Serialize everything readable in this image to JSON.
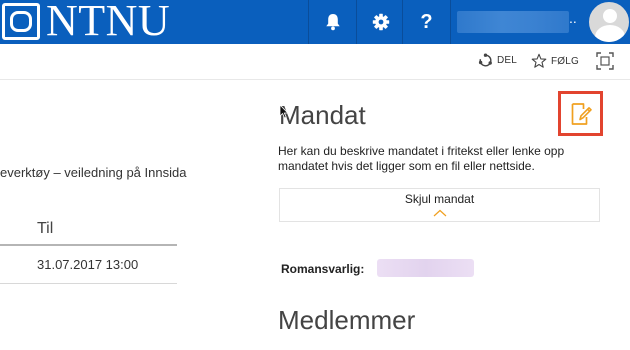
{
  "brand": {
    "logo_text": "NTNU"
  },
  "suite_bar": {
    "notifications_icon": "bell-icon",
    "settings_icon": "gear-icon",
    "help_label": "?",
    "user_dots": "..",
    "bg_color": "#0a5fbd"
  },
  "action_bar": {
    "share_label": "DEL",
    "follow_label": "FØLG",
    "focus_icon": "focus-mode-icon"
  },
  "left_panel": {
    "partial_text": "everktøy – veiledning på Innsida",
    "table": {
      "column_header": "Til",
      "rows": [
        {
          "til": "31.07.2017 13:00"
        }
      ]
    }
  },
  "mandat": {
    "title": "Mandat",
    "description": "Her kan du beskrive mandatet i fritekst eller lenke opp mandatet hvis det ligger som en fil eller nettside.",
    "toggle_label": "Skjul mandat",
    "edit_icon": "edit-icon",
    "highlight_color": "#e2442f"
  },
  "romansvarlig": {
    "label": "Romansvarlig:"
  },
  "members": {
    "title": "Medlemmer"
  }
}
